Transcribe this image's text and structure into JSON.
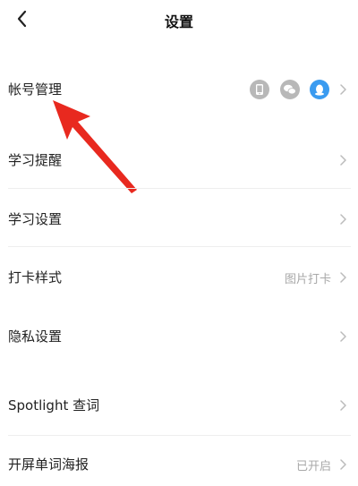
{
  "header": {
    "title": "设置",
    "back_icon": "chevron-left-icon"
  },
  "rows": [
    {
      "label": "帐号管理",
      "value": ""
    },
    {
      "label": "学习提醒",
      "value": ""
    },
    {
      "label": "学习设置",
      "value": ""
    },
    {
      "label": "打卡样式",
      "value": "图片打卡"
    },
    {
      "label": "隐私设置",
      "value": ""
    },
    {
      "label": "Spotlight 查词",
      "value": ""
    },
    {
      "label": "开屏单词海报",
      "value": "已开启"
    }
  ],
  "account_badges": [
    {
      "icon": "phone-icon",
      "color": "#b8b8b8",
      "bound": false
    },
    {
      "icon": "wechat-icon",
      "color": "#b8b8b8",
      "bound": false
    },
    {
      "icon": "qq-icon",
      "color": "#3a9bf0",
      "bound": true
    }
  ],
  "colors": {
    "annotation_arrow": "#e8291f",
    "secondary_text": "#a8a8a8",
    "divider": "#eeeeee"
  }
}
